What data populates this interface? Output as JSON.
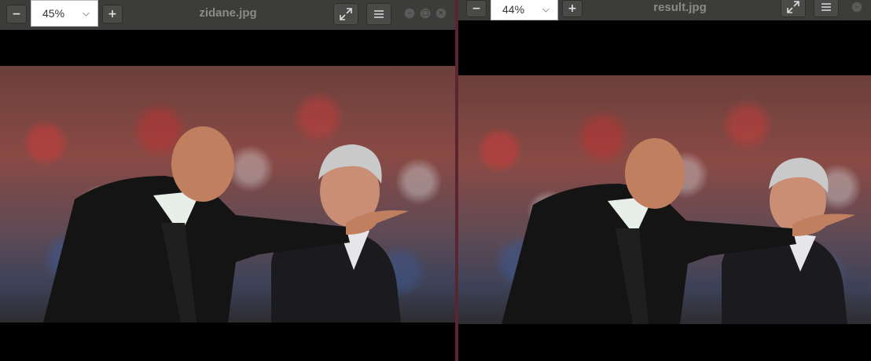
{
  "left_window": {
    "zoom_value": "45%",
    "title": "zidane.jpg",
    "zoom_out_label": "−",
    "zoom_in_label": "+",
    "fullscreen_icon": "expand-icon",
    "menu_icon": "hamburger-menu-icon"
  },
  "right_window": {
    "zoom_value": "44%",
    "title": "result.jpg",
    "zoom_out_label": "−",
    "zoom_in_label": "+",
    "fullscreen_icon": "expand-icon",
    "menu_icon": "hamburger-menu-icon"
  },
  "colors": {
    "titlebar": "#3c3c3a",
    "divider": "#5a2430",
    "canvas": "#000000"
  }
}
